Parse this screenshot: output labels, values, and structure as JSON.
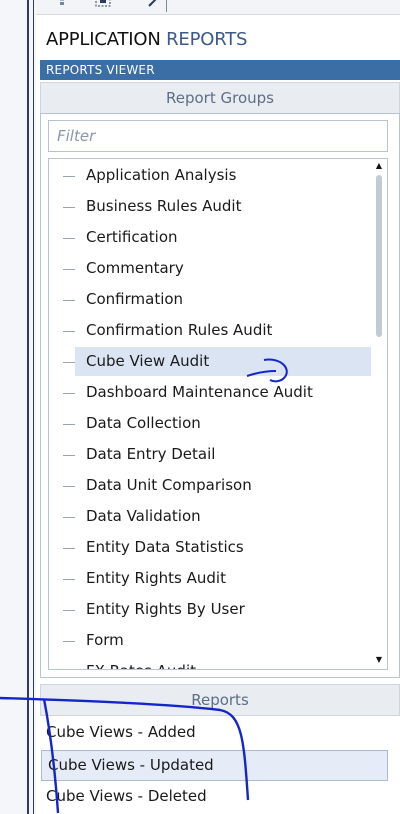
{
  "app_title": {
    "part1": "APPLICATION",
    "part2": "REPORTS"
  },
  "viewer_bar": {
    "label": "REPORTS VIEWER"
  },
  "report_groups": {
    "header": "Report Groups",
    "filter_placeholder": "Filter",
    "items": [
      {
        "label": "Application Analysis",
        "selected": false
      },
      {
        "label": "Business Rules Audit",
        "selected": false
      },
      {
        "label": "Certification",
        "selected": false
      },
      {
        "label": "Commentary",
        "selected": false
      },
      {
        "label": "Confirmation",
        "selected": false
      },
      {
        "label": "Confirmation Rules Audit",
        "selected": false
      },
      {
        "label": "Cube View Audit",
        "selected": true
      },
      {
        "label": "Dashboard Maintenance Audit",
        "selected": false
      },
      {
        "label": "Data Collection",
        "selected": false
      },
      {
        "label": "Data Entry Detail",
        "selected": false
      },
      {
        "label": "Data Unit Comparison",
        "selected": false
      },
      {
        "label": "Data Validation",
        "selected": false
      },
      {
        "label": "Entity Data Statistics",
        "selected": false
      },
      {
        "label": "Entity Rights Audit",
        "selected": false
      },
      {
        "label": "Entity Rights By User",
        "selected": false
      },
      {
        "label": "Form",
        "selected": false
      },
      {
        "label": "FX Rates Audit",
        "selected": false
      }
    ]
  },
  "reports": {
    "header": "Reports",
    "items": [
      {
        "label": "Cube Views - Added",
        "selected": false
      },
      {
        "label": "Cube Views - Updated",
        "selected": true
      },
      {
        "label": "Cube Views - Deleted",
        "selected": false
      }
    ]
  },
  "colors": {
    "accent_bar": "#3a6ea5",
    "selection": "#dbe4f3",
    "annotation_ink": "#1326c9"
  },
  "icons": [
    "bulb-icon",
    "grid-select-icon",
    "pencil-icon"
  ]
}
